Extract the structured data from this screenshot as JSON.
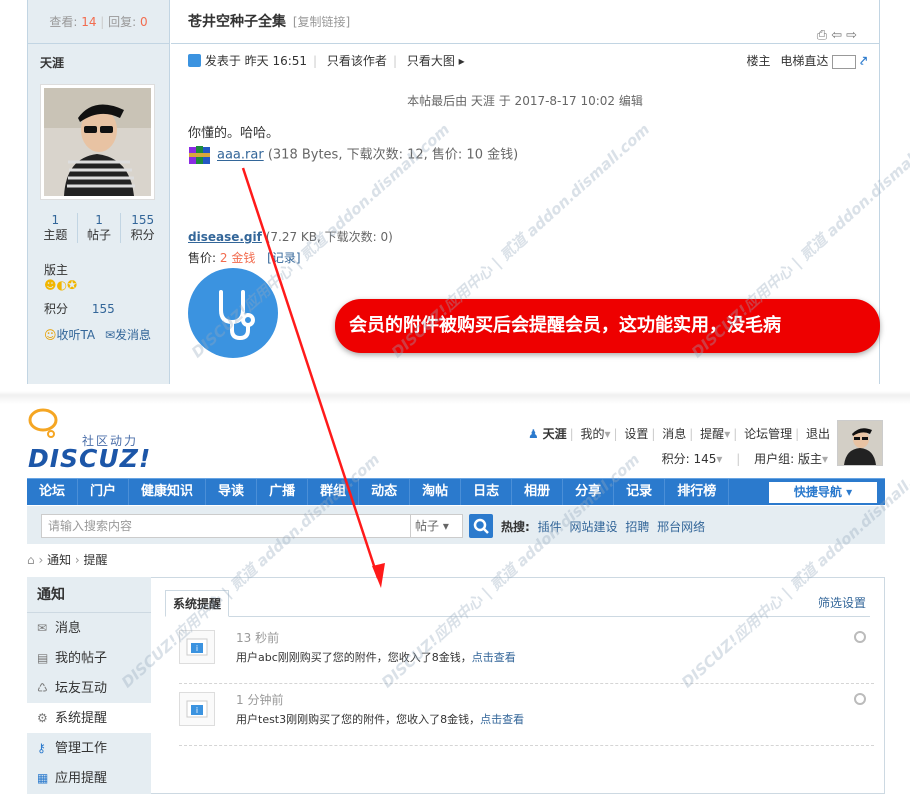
{
  "thread": {
    "views_label": "查看:",
    "views": "14",
    "replies_label": "回复:",
    "replies": "0",
    "title": "苍井空种子全集",
    "copy_link": "[复制链接]",
    "author": {
      "name": "天涯",
      "stats": [
        {
          "value": "1",
          "label": "主题"
        },
        {
          "value": "1",
          "label": "帖子"
        },
        {
          "value": "155",
          "label": "积分"
        }
      ],
      "group": "版主",
      "credit_label": "积分",
      "credit": "155",
      "follow": "收听TA",
      "message": "发消息"
    },
    "meta": {
      "posted": "发表于 昨天 16:51",
      "only_author": "只看该作者",
      "big_image": "只看大图 ▸",
      "floor": "楼主",
      "jump": "电梯直达"
    },
    "edit_note": "本帖最后由 天涯 于 2017-8-17 10:02 编辑",
    "body": "你懂的。哈哈。",
    "attachment1": {
      "name": "aaa.rar",
      "info": "(318 Bytes, 下载次数: 12, 售价: 10 金钱)"
    },
    "attachment2": {
      "name": "disease.gif",
      "info": "(7.27 KB, 下载次数: 0)"
    },
    "price": {
      "label": "售价:",
      "value": "2 金钱",
      "record": "[记录]"
    }
  },
  "banner": "会员的附件被购买后会提醒会员，这功能实用，没毛病",
  "header": {
    "logo_sub": "社区动力",
    "logo_main": "DISCUZ!",
    "user": "天涯",
    "links": [
      "我的",
      "设置",
      "消息",
      "提醒",
      "论坛管理",
      "退出"
    ],
    "credit": "积分: 145",
    "usergroup": "用户组: 版主"
  },
  "nav": {
    "items": [
      "论坛",
      "门户",
      "健康知识",
      "导读",
      "广播",
      "群组",
      "动态",
      "淘帖",
      "日志",
      "相册",
      "分享",
      "记录",
      "排行榜"
    ],
    "quick": "快捷导航 ▾"
  },
  "search": {
    "placeholder": "请输入搜索内容",
    "type": "帖子 ▾",
    "hot_label": "热搜:",
    "hot": [
      "插件",
      "网站建设",
      "招聘",
      "邢台网络"
    ]
  },
  "breadcrumb": [
    "通知",
    "提醒"
  ],
  "sidebar": {
    "title": "通知",
    "items": [
      {
        "label": "消息",
        "icon": "mail-icon"
      },
      {
        "label": "我的帖子",
        "icon": "doc-icon"
      },
      {
        "label": "坛友互动",
        "icon": "recycle-icon"
      },
      {
        "label": "系统提醒",
        "icon": "gear-icon"
      },
      {
        "label": "管理工作",
        "icon": "key-icon"
      },
      {
        "label": "应用提醒",
        "icon": "grid-icon"
      }
    ]
  },
  "notices": {
    "tab": "系统提醒",
    "filter": "筛选设置",
    "items": [
      {
        "time": "13 秒前",
        "text": "用户abc刚刚购买了您的附件，您收入了8金钱，",
        "link": "点击查看"
      },
      {
        "time": "1 分钟前",
        "text": "用户test3刚刚购买了您的附件，您收入了8金钱，",
        "link": "点击查看"
      }
    ]
  },
  "watermark": "DISCUZ!应用中心 | 贰道 addon.dismall.com",
  "colors": {
    "nav": "#2b7acd",
    "banner": "#ee0000",
    "panel": "#e5edf2",
    "link": "#336699"
  }
}
